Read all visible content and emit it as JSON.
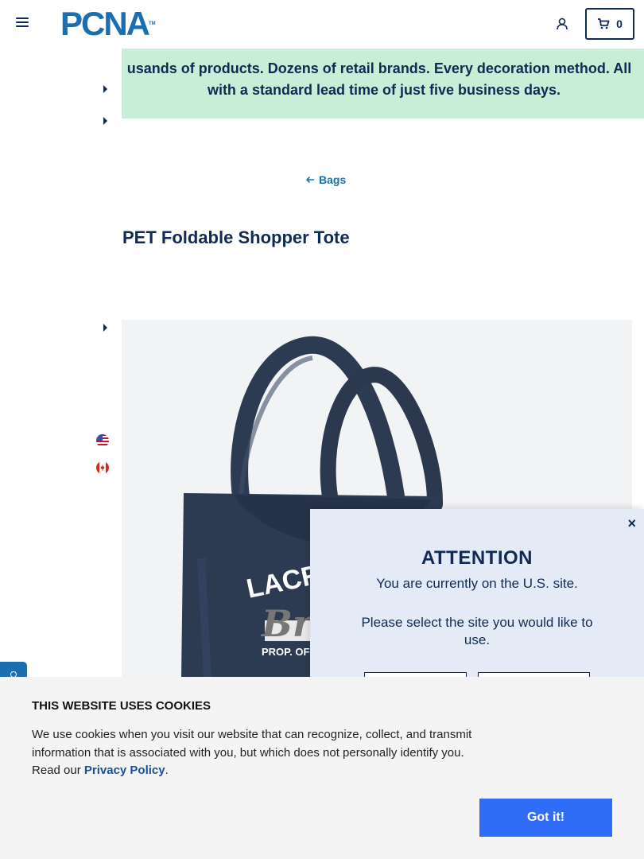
{
  "header": {
    "logo_text": "PCNA",
    "logo_tm": "TM",
    "cart_count": "0",
    "accent_color": "#1a6fb0"
  },
  "banner": {
    "line1": "usands of products. Dozens of retail brands. Every decoration method. All",
    "line2": "with a standard lead time of just five business days.",
    "background": "#c7efd7"
  },
  "breadcrumb": {
    "label": "Bags"
  },
  "product": {
    "title": "PET Foldable Shopper Tote",
    "print_line1": "LACR",
    "print_line2": "Bro",
    "print_line3": "PROP. OF",
    "bag_color": "#2d3b52"
  },
  "flags": [
    "us-flag-icon",
    "canada-flag-icon"
  ],
  "modal": {
    "title": "ATTENTION",
    "message1": "You are currently on the U.S. site.",
    "message2": "Please select the site you would like to use.",
    "close_label": "×"
  },
  "cookie": {
    "title": "THIS WEBSITE USES COOKIES",
    "text": "We use cookies when you visit our website that can recognize, collect, and transmit information that is associated with you, but which does not personally identify you. Read our ",
    "link_label": "Privacy Policy",
    "period": ".",
    "button_label": "Got it!",
    "button_color": "#2f6df6"
  }
}
